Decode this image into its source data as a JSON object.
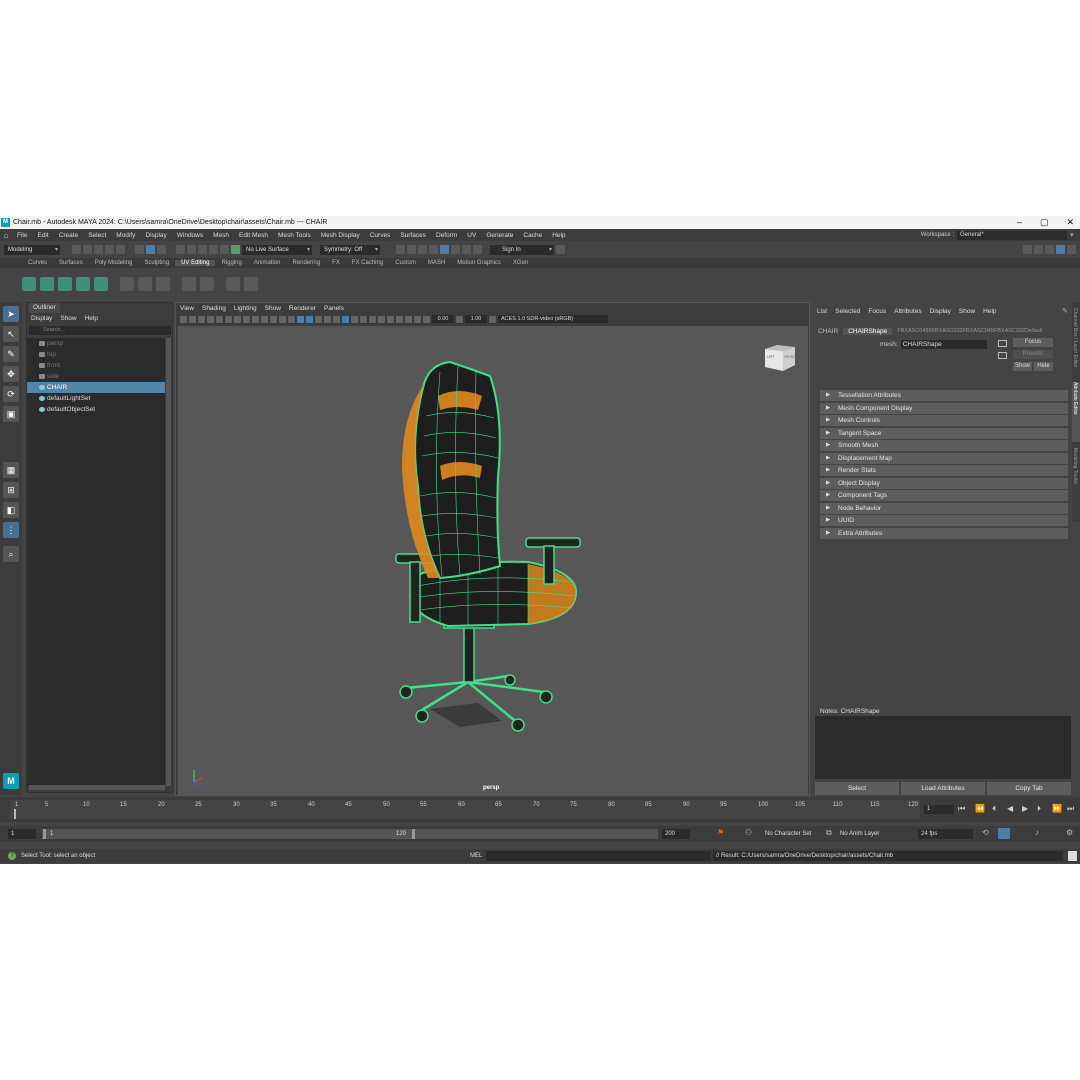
{
  "window": {
    "title": "Chair.mb - Autodesk MAYA 2024: C:\\Users\\samra\\OneDrive\\Desktop\\chair\\assets\\Chair.mb  ---  CHAIR",
    "logo": "M"
  },
  "menubar": {
    "items": [
      "File",
      "Edit",
      "Create",
      "Select",
      "Modify",
      "Display",
      "Windows",
      "Mesh",
      "Edit Mesh",
      "Mesh Tools",
      "Mesh Display",
      "Curves",
      "Surfaces",
      "Deform",
      "UV",
      "Generate",
      "Cache",
      "Help"
    ],
    "workspace_label": "Workspace :",
    "workspace_value": "General*"
  },
  "statusline": {
    "mode": "Modeling",
    "live_surface": "No Live Surface",
    "symmetry": "Symmetry: Off",
    "sign_in": "Sign In"
  },
  "shelf_tabs": [
    "Curves",
    "Surfaces",
    "Poly Modeling",
    "Sculpting",
    "UV Editing",
    "Rigging",
    "Animation",
    "Rendering",
    "FX",
    "FX Caching",
    "Custom",
    "MASH",
    "Motion Graphics",
    "XGen"
  ],
  "shelf_active": "UV Editing",
  "outliner": {
    "tab": "Outliner",
    "menu": [
      "Display",
      "Show",
      "Help"
    ],
    "search_placeholder": "Search...",
    "nodes": [
      {
        "label": "persp",
        "state": "dim"
      },
      {
        "label": "top",
        "state": "dim"
      },
      {
        "label": "front",
        "state": "dim"
      },
      {
        "label": "side",
        "state": "dim"
      },
      {
        "label": "CHAIR",
        "state": "selected"
      },
      {
        "label": "defaultLightSet",
        "state": "normal"
      },
      {
        "label": "defaultObjectSet",
        "state": "normal"
      }
    ]
  },
  "viewport": {
    "menu": [
      "View",
      "Shading",
      "Lighting",
      "Show",
      "Renderer",
      "Panels"
    ],
    "exposure": "0.00",
    "gamma": "1.00",
    "color_space": "ACES 1.0 SDR-video (sRGB)",
    "camera": "persp",
    "viewcube_label": "FRONT",
    "viewcube_side": "LEFT",
    "wire_color": "#3ee08a",
    "accent_color": "#e08a1e"
  },
  "attribute_editor": {
    "menu": [
      "List",
      "Selected",
      "Focus",
      "Attributes",
      "Display",
      "Show",
      "Help"
    ],
    "node_tabs": [
      "CHAIR",
      "CHAIRShape",
      "FBXASC0496FBXASC032FBXASC045FBXASC032Default"
    ],
    "active_tab": "CHAIRShape",
    "mesh_label": "mesh:",
    "mesh_value": "CHAIRShape",
    "focus_btn": "Focus",
    "presets_btn": "Presets",
    "show_btn": "Show",
    "hide_btn": "Hide",
    "sections": [
      "Tessellation Attributes",
      "Mesh Component Display",
      "Mesh Controls",
      "Tangent Space",
      "Smooth Mesh",
      "Displacement Map",
      "Render Stats",
      "Object Display",
      "Component Tags",
      "Node Behavior",
      "UUID",
      "Extra Attributes"
    ],
    "notes_label": "Notes:  CHAIRShape",
    "buttons": [
      "Select",
      "Load Attributes",
      "Copy Tab"
    ]
  },
  "side_tabs": [
    "Channel Box / Layer Editor",
    "Attribute Editor",
    "Modeling Toolkit"
  ],
  "timeline": {
    "ticks": [
      "1",
      "5",
      "10",
      "15",
      "20",
      "25",
      "30",
      "35",
      "40",
      "45",
      "50",
      "55",
      "60",
      "65",
      "70",
      "75",
      "80",
      "85",
      "90",
      "95",
      "100",
      "105",
      "110",
      "115",
      "120"
    ],
    "current_frame": "1",
    "range_start": "1",
    "range_inner_start": "1",
    "range_inner_end": "120",
    "range_end": "200",
    "character_set": "No Character Set",
    "anim_layer": "No Anim Layer",
    "fps": "24 fps"
  },
  "command_line": {
    "help_text": "Select Tool: select an object",
    "lang": "MEL",
    "result": "// Result: C:/Users/samra/OneDrive/Desktop/chair/assets/Chair.mb"
  }
}
